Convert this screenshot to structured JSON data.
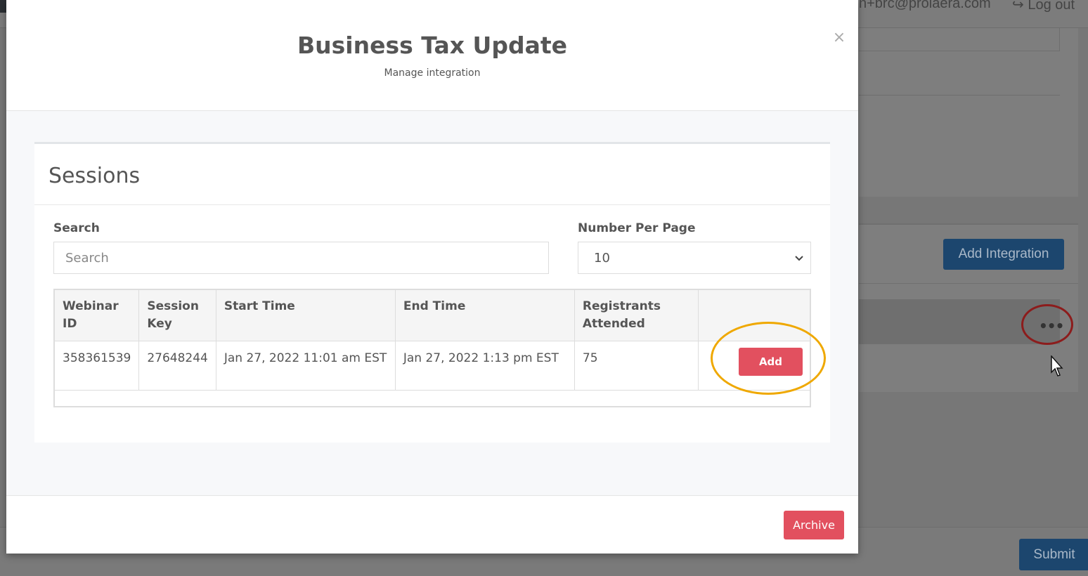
{
  "background": {
    "user_email": "n+brc@prolaera.com",
    "logout_label": "Log out",
    "add_integration_label": "Add Integration",
    "more_options_label": "•••",
    "submit_label": "Submit"
  },
  "modal": {
    "title": "Business Tax Update",
    "subtitle": "Manage integration",
    "close_label": "×",
    "sessions": {
      "heading": "Sessions",
      "search_label": "Search",
      "search_placeholder": "Search",
      "per_page_label": "Number Per Page",
      "per_page_value": "10",
      "columns": {
        "webinar_id": "Webinar ID",
        "session_key": "Session Key",
        "start_time": "Start Time",
        "end_time": "End Time",
        "registrants": "Registrants Attended"
      },
      "rows": [
        {
          "webinar_id": "358361539",
          "session_key": "27648244",
          "start_time": "Jan 27, 2022 11:01 am EST",
          "end_time": "Jan 27, 2022 1:13 pm EST",
          "registrants": "75",
          "action_label": "Add"
        }
      ]
    },
    "archive_label": "Archive"
  },
  "colors": {
    "primary_dark": "#1c466e",
    "danger": "#e2505f",
    "highlight_orange": "#efa800",
    "highlight_red": "#8c1c1c"
  }
}
